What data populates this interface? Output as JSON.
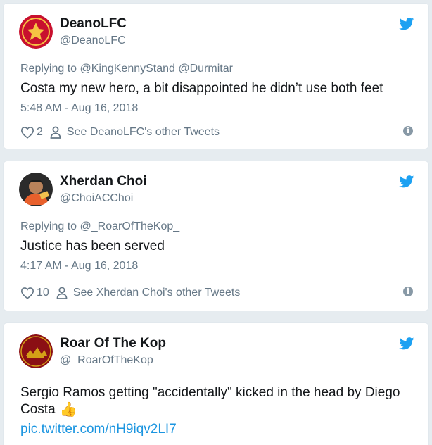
{
  "colors": {
    "background": "#e6ecf0",
    "card": "#ffffff",
    "text_primary": "#14171a",
    "text_secondary": "#657786",
    "link": "#1b95e0",
    "twitter_bird": "#1da1f2"
  },
  "tweets": [
    {
      "name": "DeanoLFC",
      "handle": "@DeanoLFC",
      "reply_to": "Replying to @KingKennyStand @Durmitar",
      "text": "Costa my new hero, a bit disappointed he didn’t use both feet",
      "time": "5:48 AM - Aug 16, 2018",
      "likes": "2",
      "other_tweets": "See DeanoLFC's other Tweets",
      "icons": [
        "avatar",
        "twitter-bird-icon",
        "heart-icon",
        "person-icon",
        "info-icon"
      ]
    },
    {
      "name": "Xherdan Choi",
      "handle": "@ChoiACChoi",
      "reply_to": "Replying to @_RoarOfTheKop_",
      "text": "Justice has been served",
      "time": "4:17 AM - Aug 16, 2018",
      "likes": "10",
      "other_tweets": "See Xherdan Choi's other Tweets",
      "icons": [
        "avatar",
        "twitter-bird-icon",
        "heart-icon",
        "person-icon",
        "info-icon"
      ]
    },
    {
      "name": "Roar Of The Kop",
      "handle": "@_RoarOfTheKop_",
      "text_line_1": "Sergio Ramos getting \"accidentally\" kicked in the head by Diego",
      "text_line_2": "Costa",
      "link": "pic.twitter.com/nH9iqv2LI7",
      "icons": [
        "avatar",
        "twitter-bird-icon",
        "thumbs-up-icon"
      ]
    }
  ]
}
